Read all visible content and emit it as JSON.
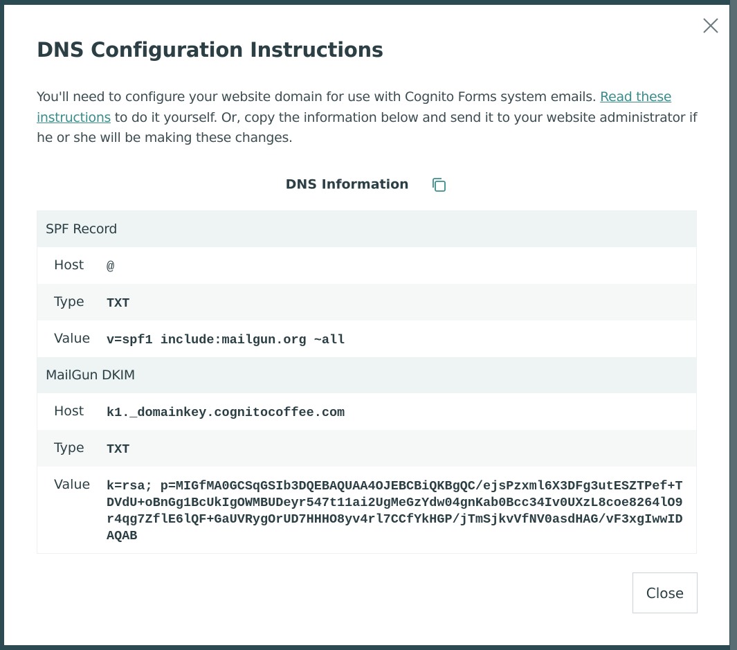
{
  "dialog": {
    "title": "DNS Configuration Instructions",
    "close_icon": "close-icon",
    "intro": {
      "before_link": "You'll need to configure your website domain for use with Cognito Forms system emails. ",
      "link_text": "Read these instructions",
      "after_link": " to do it yourself. Or, copy the information below and send it to your website administrator if he or she will be making these changes."
    },
    "dns_heading": "DNS Information",
    "copy_icon": "copy-icon",
    "sections": [
      {
        "title": "SPF Record",
        "rows": [
          {
            "label": "Host",
            "value": "@"
          },
          {
            "label": "Type",
            "value": "TXT"
          },
          {
            "label": "Value",
            "value": "v=spf1 include:mailgun.org ~all"
          }
        ]
      },
      {
        "title": "MailGun DKIM",
        "rows": [
          {
            "label": "Host",
            "value": "k1._domainkey.cognitocoffee.com"
          },
          {
            "label": "Type",
            "value": "TXT"
          },
          {
            "label": "Value",
            "value": "k=rsa; p=MIGfMA0GCSqGSIb3DQEBAQUAA4OJEBCBiQKBgQC/ejsPzxml6X3DFg3utESZTPef+TDVdU+oBnGg1BcUkIgOWMBUDeyr547t11ai2UgMeGzYdw04gnKab0Bcc34Iv0UXzL8coe8264lO9r4qg7ZflE6lQF+GaUVRygOrUD7HHHO8yv4rl7CCfYkHGP/jTmSjkvVfNV0asdHAG/vF3xgIwwIDAQAB"
          }
        ]
      }
    ],
    "close_button": "Close"
  }
}
